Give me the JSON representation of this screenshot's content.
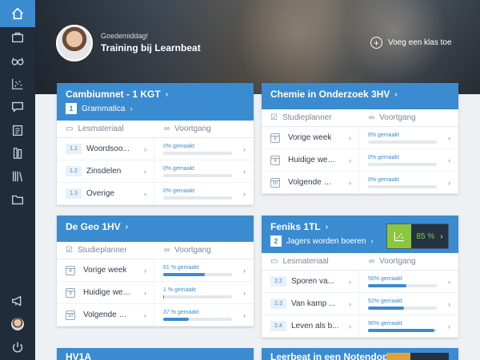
{
  "header": {
    "greeting": "Goedemiddag!",
    "title": "Training bij Learnbeat",
    "add_class": "Voeg een klas toe"
  },
  "cards": {
    "cambium": {
      "title": "Cambiumnet - 1 KGT",
      "sub_num": "1",
      "sub_label": "Grammatica",
      "col1": "Lesmateriaal",
      "col2": "Voortgang",
      "rows": [
        {
          "num": "1.1",
          "label": "Woordsoo...",
          "pct_text": "0% gemaakt",
          "pct": 0
        },
        {
          "num": "1.2",
          "label": "Zinsdelen",
          "pct_text": "0% gemaakt",
          "pct": 0
        },
        {
          "num": "1.3",
          "label": "Overige",
          "pct_text": "0% gemaakt",
          "pct": 0
        }
      ]
    },
    "chemie": {
      "title": "Chemie in Onderzoek 3HV",
      "col1": "Studieplanner",
      "col2": "Voortgang",
      "rows": [
        {
          "num": "8",
          "label": "Vorige week",
          "pct_text": "0% gemaakt",
          "pct": 0
        },
        {
          "num": "9",
          "label": "Huidige week",
          "pct_text": "0% gemaakt",
          "pct": 0
        },
        {
          "num": "10",
          "label": "Volgende week",
          "pct_text": "0% gemaakt",
          "pct": 0
        }
      ]
    },
    "geo": {
      "title": "De Geo 1HV",
      "col1": "Studieplanner",
      "col2": "Voortgang",
      "rows": [
        {
          "num": "8",
          "label": "Vorige week",
          "pct_text": "61 % gemaakt",
          "pct": 61
        },
        {
          "num": "9",
          "label": "Huidige week",
          "pct_text": "1 % gemaakt",
          "pct": 1
        },
        {
          "num": "10",
          "label": "Volgende we...",
          "pct_text": "37 % gemaakt",
          "pct": 37
        }
      ]
    },
    "feniks": {
      "title": "Feniks 1TL",
      "sub_num": "2",
      "sub_label": "Jagers worden boeren",
      "stat": "85 %",
      "col1": "Lesmateriaal",
      "col2": "Voortgang",
      "rows": [
        {
          "num": "2.2",
          "label": "Sporen va...",
          "pct_text": "56% gemaakt",
          "pct": 56
        },
        {
          "num": "2.3",
          "label": "Van kamp ...",
          "pct_text": "52% gemaakt",
          "pct": 52
        },
        {
          "num": "2.4",
          "label": "Leven als b...",
          "pct_text": "96% gemaakt",
          "pct": 96
        }
      ]
    },
    "hv1a": {
      "title": "HV1A"
    },
    "leer": {
      "title": "Leerbeat in een Notendop"
    }
  },
  "icons": {
    "sidebar": [
      "home-icon",
      "briefcase-icon",
      "glasses-icon",
      "scatter-icon",
      "chat-icon",
      "clipboard-icon",
      "books-icon",
      "library-icon",
      "folder-icon",
      "megaphone-icon",
      "user-avatar-icon",
      "power-icon"
    ]
  },
  "colors": {
    "accent": "#3b8bd0",
    "sidebar": "#1f2d3a",
    "good": "#8cc63f"
  }
}
